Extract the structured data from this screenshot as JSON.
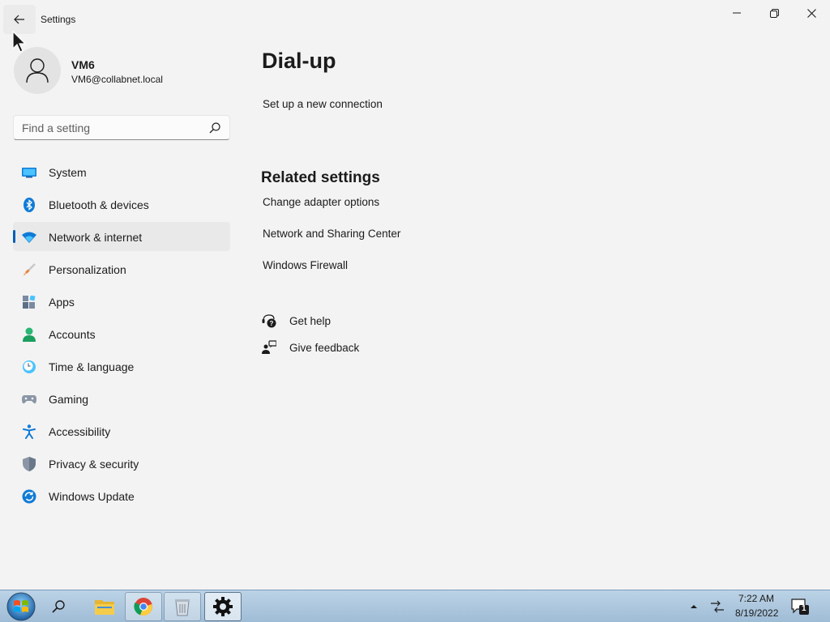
{
  "window": {
    "title": "Settings",
    "back_icon": "arrow-left-icon",
    "minimize_icon": "minimize-icon",
    "maximize_icon": "restore-icon",
    "close_icon": "close-icon"
  },
  "profile": {
    "name": "VM6",
    "email": "VM6@collabnet.local"
  },
  "search": {
    "placeholder": "Find a setting",
    "value": ""
  },
  "sidebar": {
    "items": [
      {
        "label": "System",
        "icon": "system-icon",
        "active": false
      },
      {
        "label": "Bluetooth & devices",
        "icon": "bluetooth-icon",
        "active": false
      },
      {
        "label": "Network & internet",
        "icon": "wifi-icon",
        "active": true
      },
      {
        "label": "Personalization",
        "icon": "brush-icon",
        "active": false
      },
      {
        "label": "Apps",
        "icon": "apps-icon",
        "active": false
      },
      {
        "label": "Accounts",
        "icon": "accounts-icon",
        "active": false
      },
      {
        "label": "Time & language",
        "icon": "clock-globe-icon",
        "active": false
      },
      {
        "label": "Gaming",
        "icon": "gamepad-icon",
        "active": false
      },
      {
        "label": "Accessibility",
        "icon": "accessibility-icon",
        "active": false
      },
      {
        "label": "Privacy & security",
        "icon": "shield-icon",
        "active": false
      },
      {
        "label": "Windows Update",
        "icon": "update-icon",
        "active": false
      }
    ]
  },
  "main": {
    "title": "Dial-up",
    "setup_link": "Set up a new connection",
    "related_title": "Related settings",
    "related_links": [
      "Change adapter options",
      "Network and Sharing Center",
      "Windows Firewall"
    ],
    "help": {
      "label": "Get help",
      "icon": "help-icon"
    },
    "feedback": {
      "label": "Give feedback",
      "icon": "feedback-icon"
    }
  },
  "taskbar": {
    "time": "7:22 AM",
    "date": "8/19/2022",
    "notification_count": "1",
    "apps": [
      "file-explorer-icon",
      "chrome-icon",
      "recycle-bin-icon",
      "settings-gear-icon"
    ]
  },
  "colors": {
    "accent": "#005fb8",
    "background": "#f3f3f3"
  }
}
